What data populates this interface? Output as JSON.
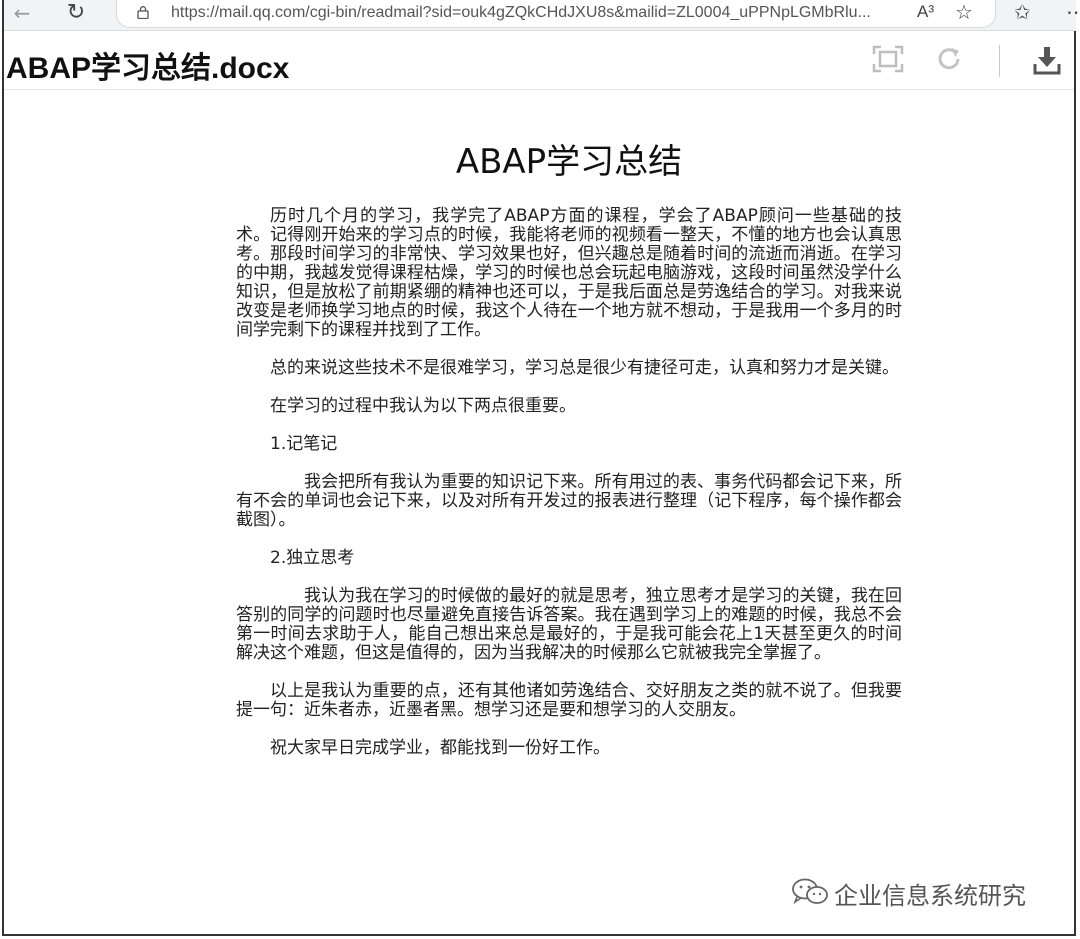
{
  "browser": {
    "url": "https://mail.qq.com/cgi-bin/readmail?sid=ouk4gZQkCHdJXU8s&mailid=ZL0004_uPPNpLGMbRlu...",
    "read_aloud_label": "A³"
  },
  "doc_header": {
    "filename": "ABAP学习总结.docx"
  },
  "document": {
    "title": "ABAP学习总结",
    "paragraphs": [
      "历时几个月的学习，我学完了ABAP方面的课程，学会了ABAP顾问一些基础的技术。记得刚开始来的学习点的时候，我能将老师的视频看一整天，不懂的地方也会认真思考。那段时间学习的非常快、学习效果也好，但兴趣总是随着时间的流逝而消逝。在学习的中期，我越发觉得课程枯燥，学习的时候也总会玩起电脑游戏，这段时间虽然没学什么知识，但是放松了前期紧绷的精神也还可以，于是我后面总是劳逸结合的学习。对我来说改变是老师换学习地点的时候，我这个人待在一个地方就不想动，于是我用一个多月的时间学完剩下的课程并找到了工作。",
      "总的来说这些技术不是很难学习，学习总是很少有捷径可走，认真和努力才是关键。",
      "在学习的过程中我认为以下两点很重要。",
      "1.记笔记",
      "我会把所有我认为重要的知识记下来。所有用过的表、事务代码都会记下来，所有不会的单词也会记下来，以及对所有开发过的报表进行整理（记下程序，每个操作都会截图）。",
      "2.独立思考",
      "我认为我在学习的时候做的最好的就是思考，独立思考才是学习的关键，我在回答别的同学的问题时也尽量避免直接告诉答案。我在遇到学习上的难题的时候，我总不会第一时间去求助于人，能自己想出来总是最好的，于是我可能会花上1天甚至更久的时间解决这个难题，但这是值得的，因为当我解决的时候那么它就被我完全掌握了。",
      "以上是我认为重要的点，还有其他诸如劳逸结合、交好朋友之类的就不说了。但我要提一句：近朱者赤，近墨者黑。想学习还是要和想学习的人交朋友。",
      "祝大家早日完成学业，都能找到一份好工作。"
    ]
  },
  "watermark": {
    "text": "企业信息系统研究"
  }
}
